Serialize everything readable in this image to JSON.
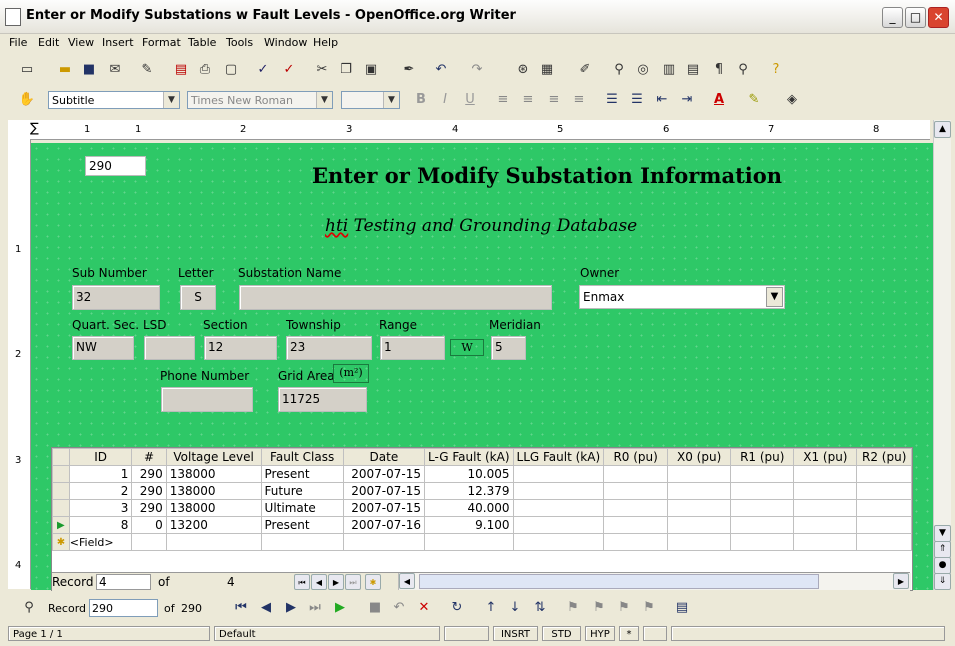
{
  "window": {
    "title": "Enter or Modify Substations w Fault Levels - OpenOffice.org Writer",
    "minimize": "_",
    "maximize": "□",
    "close": "✕"
  },
  "menu": [
    "File",
    "Edit",
    "View",
    "Insert",
    "Format",
    "Table",
    "Tools",
    "Window",
    "Help"
  ],
  "format_bar": {
    "style": "Subtitle",
    "font": "Times New Roman",
    "size": ""
  },
  "ruler": {
    "marks": [
      "1",
      "1",
      "2",
      "3",
      "4",
      "5",
      "6",
      "7",
      "8"
    ],
    "vmarks": [
      "1",
      "2",
      "3",
      "4"
    ]
  },
  "form": {
    "id_value": "290",
    "title": "Enter or Modify Substation Information",
    "subtitle_prefix": "hti",
    "subtitle_rest": " Testing and Grounding Database",
    "labels": {
      "sub_number": "Sub Number",
      "letter": "Letter",
      "substation_name": "Substation Name",
      "owner": "Owner",
      "quart_sec": "Quart. Sec.",
      "lsd": "LSD",
      "section": "Section",
      "township": "Township",
      "range": "Range",
      "meridian": "Meridian",
      "phone": "Phone Number",
      "grid_area": "Grid Area",
      "grid_area_unit": "(m²)",
      "range_dir": "W"
    },
    "values": {
      "sub_number": "32",
      "letter": "S",
      "substation_name": "",
      "owner": "Enmax",
      "quart_sec": "NW",
      "lsd": "",
      "section": "12",
      "township": "23",
      "range": "1",
      "meridian": "5",
      "phone": "",
      "grid_area": "11725"
    }
  },
  "grid": {
    "columns": [
      "ID",
      "#",
      "Voltage Level",
      "Fault Class",
      "Date",
      "L-G Fault (kA)",
      "LLG Fault (kA)",
      "R0 (pu)",
      "X0 (pu)",
      "R1 (pu)",
      "X1 (pu)",
      "R2 (pu)"
    ],
    "rows": [
      [
        "1",
        "290",
        "138000",
        "Present",
        "2007-07-15",
        "10.005",
        "",
        "",
        "",
        "",
        "",
        ""
      ],
      [
        "2",
        "290",
        "138000",
        "Future",
        "2007-07-15",
        "12.379",
        "",
        "",
        "",
        "",
        "",
        ""
      ],
      [
        "3",
        "290",
        "138000",
        "Ultimate",
        "2007-07-15",
        "40.000",
        "",
        "",
        "",
        "",
        "",
        ""
      ],
      [
        "8",
        "0",
        "13200",
        "Present",
        "2007-07-16",
        "9.100",
        "",
        "",
        "",
        "",
        "",
        ""
      ]
    ],
    "new_row": "<Field>",
    "nav": {
      "record_label": "Record",
      "record_value": "4",
      "of_label": "of",
      "total": "4"
    }
  },
  "form_navigation": {
    "record_label": "Record",
    "record_value": "290",
    "of_label": "of",
    "total": "290"
  },
  "status": {
    "page": "Page 1 / 1",
    "style": "Default",
    "insrt": "INSRT",
    "std": "STD",
    "hyp": "HYP",
    "star": "*"
  },
  "colors": {
    "form_bg": "#2ec867",
    "annotation_arrow": "#e01010"
  }
}
